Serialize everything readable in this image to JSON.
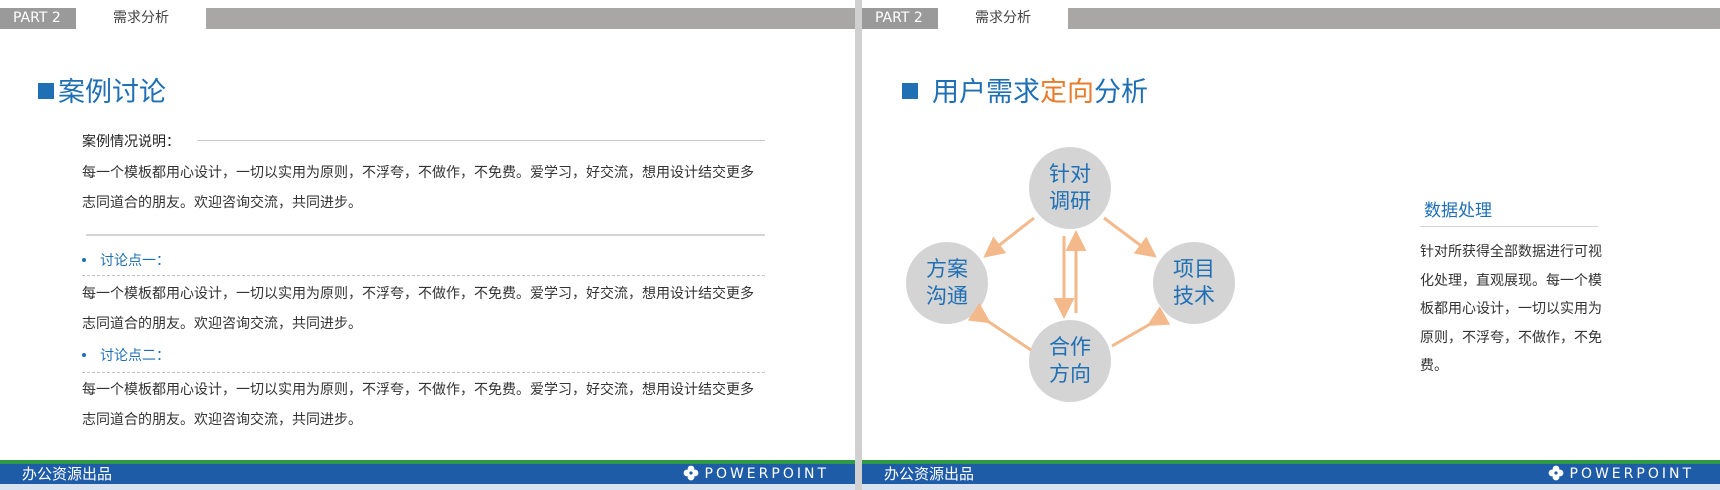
{
  "left_slide": {
    "header": {
      "part": "PART 2",
      "section": "需求分析"
    },
    "title": "案例讨论",
    "case_label": "案例情况说明：",
    "case_text": "每一个模板都用心设计，一切以实用为原则，不浮夸，不做作，不免费。爱学习，好交流，想用设计结交更多志同道合的朋友。欢迎咨询交流，共同进步。",
    "points": [
      {
        "label": "讨论点一：",
        "text": "每一个模板都用心设计，一切以实用为原则，不浮夸，不做作，不免费。爱学习，好交流，想用设计结交更多志同道合的朋友。欢迎咨询交流，共同进步。"
      },
      {
        "label": "讨论点二：",
        "text": "每一个模板都用心设计，一切以实用为原则，不浮夸，不做作，不免费。爱学习，好交流，想用设计结交更多志同道合的朋友。欢迎咨询交流，共同进步。"
      }
    ],
    "footer": {
      "org": "办公资源出品",
      "brand": "POWERPOINT"
    }
  },
  "right_slide": {
    "header": {
      "part": "PART 2",
      "section": "需求分析"
    },
    "title": {
      "prefix": "用户需求",
      "highlight": "定向",
      "suffix": "分析"
    },
    "diagram": {
      "nodes": [
        {
          "id": "top",
          "lines": [
            "针对",
            "调研"
          ]
        },
        {
          "id": "left",
          "lines": [
            "方案",
            "沟通"
          ]
        },
        {
          "id": "right",
          "lines": [
            "项目",
            "技术"
          ]
        },
        {
          "id": "bottom",
          "lines": [
            "合作",
            "方向"
          ]
        }
      ],
      "node_color": "#d4d4d4",
      "arrow_color": "#f3b98a"
    },
    "data_processing": {
      "title": "数据处理",
      "text": "针对所获得全部数据进行可视化处理，直观展现。每一个模板都用心设计，一切以实用为原则，不浮夸，不做作，不免费。"
    },
    "footer": {
      "org": "办公资源出品",
      "brand": "POWERPOINT"
    }
  },
  "colors": {
    "accent_blue": "#1f6fb5",
    "accent_orange": "#e87c2c",
    "header_gray": "#a9a6a6",
    "footer_blue": "#1f5ca8",
    "footer_green": "#2e9a48"
  }
}
